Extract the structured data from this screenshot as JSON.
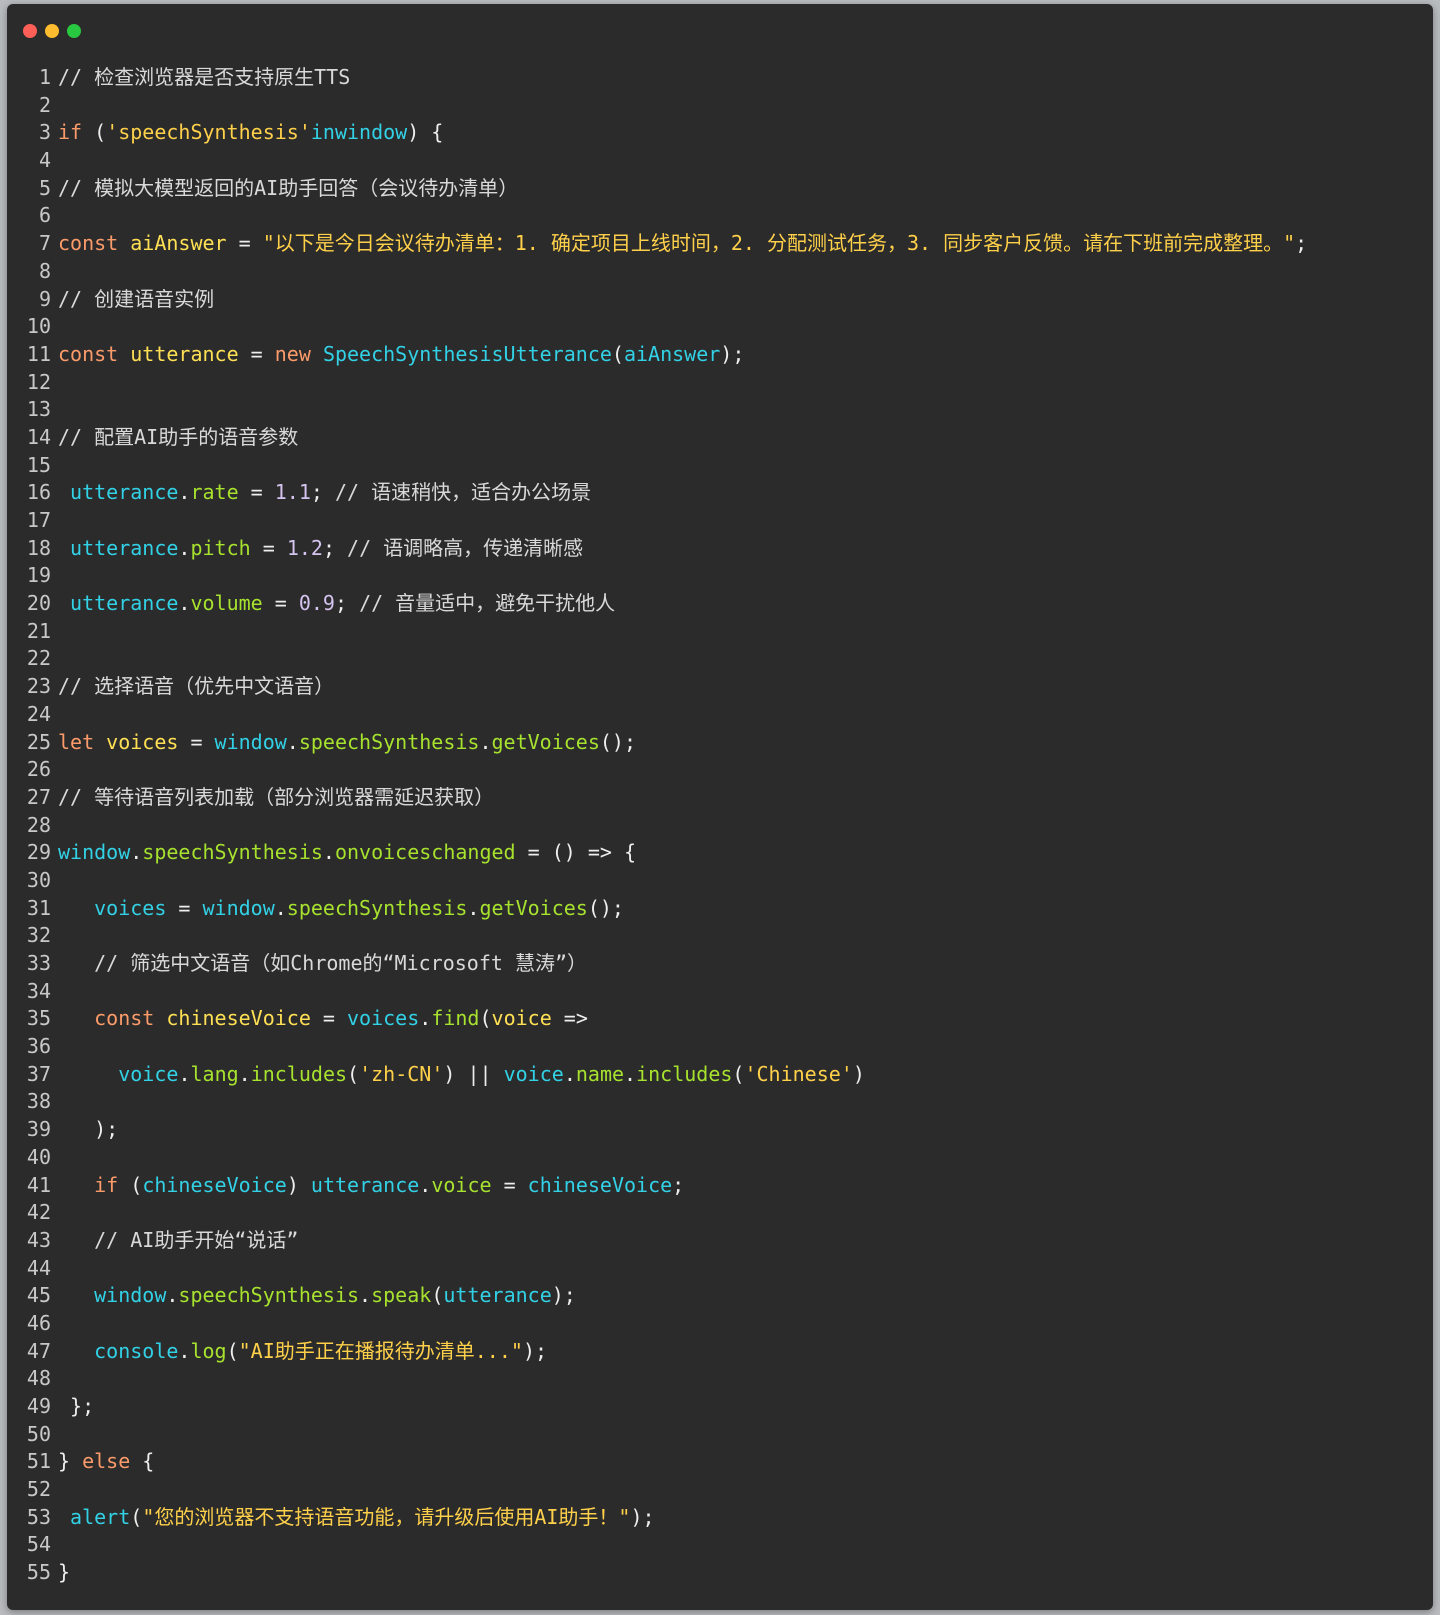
{
  "window": {
    "controls": [
      "close",
      "minimize",
      "zoom"
    ]
  },
  "code_lines": [
    [
      {
        "t": "// 检查浏览器是否支持原生TTS",
        "c": "comment"
      }
    ],
    [],
    [
      {
        "t": "if",
        "c": "keyword"
      },
      {
        "t": " (",
        "c": "punct"
      },
      {
        "t": "'speechSynthesis'",
        "c": "string"
      },
      {
        "t": "inwindow",
        "c": "builtin"
      },
      {
        "t": ") {",
        "c": "punct"
      }
    ],
    [],
    [
      {
        "t": "// 模拟大模型返回的AI助手回答（会议待办清单）",
        "c": "comment"
      }
    ],
    [],
    [
      {
        "t": "const",
        "c": "keyword"
      },
      {
        "t": " ",
        "c": "plain"
      },
      {
        "t": "aiAnswer",
        "c": "var"
      },
      {
        "t": " = ",
        "c": "punct"
      },
      {
        "t": "\"以下是今日会议待办清单：1. 确定项目上线时间，2. 分配测试任务，3. 同步客户反馈。请在下班前完成整理。\"",
        "c": "string"
      },
      {
        "t": ";",
        "c": "punct"
      }
    ],
    [],
    [
      {
        "t": "// 创建语音实例",
        "c": "comment"
      }
    ],
    [],
    [
      {
        "t": "const",
        "c": "keyword"
      },
      {
        "t": " ",
        "c": "plain"
      },
      {
        "t": "utterance",
        "c": "var"
      },
      {
        "t": " = ",
        "c": "punct"
      },
      {
        "t": "new",
        "c": "keyword"
      },
      {
        "t": " ",
        "c": "plain"
      },
      {
        "t": "SpeechSynthesisUtterance",
        "c": "builtin"
      },
      {
        "t": "(",
        "c": "punct"
      },
      {
        "t": "aiAnswer",
        "c": "builtin"
      },
      {
        "t": ");",
        "c": "punct"
      }
    ],
    [],
    [],
    [
      {
        "t": "// 配置AI助手的语音参数",
        "c": "comment"
      }
    ],
    [],
    [
      {
        "t": " ",
        "c": "plain"
      },
      {
        "t": "utterance",
        "c": "builtin"
      },
      {
        "t": ".",
        "c": "punct"
      },
      {
        "t": "rate",
        "c": "func"
      },
      {
        "t": " = ",
        "c": "punct"
      },
      {
        "t": "1.1",
        "c": "number"
      },
      {
        "t": "; ",
        "c": "punct"
      },
      {
        "t": "// 语速稍快，适合办公场景",
        "c": "comment"
      }
    ],
    [],
    [
      {
        "t": " ",
        "c": "plain"
      },
      {
        "t": "utterance",
        "c": "builtin"
      },
      {
        "t": ".",
        "c": "punct"
      },
      {
        "t": "pitch",
        "c": "func"
      },
      {
        "t": " = ",
        "c": "punct"
      },
      {
        "t": "1.2",
        "c": "number"
      },
      {
        "t": "; ",
        "c": "punct"
      },
      {
        "t": "// 语调略高，传递清晰感",
        "c": "comment"
      }
    ],
    [],
    [
      {
        "t": " ",
        "c": "plain"
      },
      {
        "t": "utterance",
        "c": "builtin"
      },
      {
        "t": ".",
        "c": "punct"
      },
      {
        "t": "volume",
        "c": "func"
      },
      {
        "t": " = ",
        "c": "punct"
      },
      {
        "t": "0.9",
        "c": "number"
      },
      {
        "t": "; ",
        "c": "punct"
      },
      {
        "t": "// 音量适中，避免干扰他人",
        "c": "comment"
      }
    ],
    [],
    [],
    [
      {
        "t": "// 选择语音（优先中文语音）",
        "c": "comment"
      }
    ],
    [],
    [
      {
        "t": "let",
        "c": "keyword"
      },
      {
        "t": " ",
        "c": "plain"
      },
      {
        "t": "voices",
        "c": "var"
      },
      {
        "t": " = ",
        "c": "punct"
      },
      {
        "t": "window",
        "c": "builtin"
      },
      {
        "t": ".",
        "c": "punct"
      },
      {
        "t": "speechSynthesis",
        "c": "func"
      },
      {
        "t": ".",
        "c": "punct"
      },
      {
        "t": "getVoices",
        "c": "func"
      },
      {
        "t": "();",
        "c": "punct"
      }
    ],
    [],
    [
      {
        "t": "// 等待语音列表加载（部分浏览器需延迟获取）",
        "c": "comment"
      }
    ],
    [],
    [
      {
        "t": "window",
        "c": "builtin"
      },
      {
        "t": ".",
        "c": "punct"
      },
      {
        "t": "speechSynthesis",
        "c": "func"
      },
      {
        "t": ".",
        "c": "punct"
      },
      {
        "t": "onvoiceschanged",
        "c": "func"
      },
      {
        "t": " = () => {",
        "c": "punct"
      }
    ],
    [],
    [
      {
        "t": "   ",
        "c": "plain"
      },
      {
        "t": "voices",
        "c": "builtin"
      },
      {
        "t": " = ",
        "c": "punct"
      },
      {
        "t": "window",
        "c": "builtin"
      },
      {
        "t": ".",
        "c": "punct"
      },
      {
        "t": "speechSynthesis",
        "c": "func"
      },
      {
        "t": ".",
        "c": "punct"
      },
      {
        "t": "getVoices",
        "c": "func"
      },
      {
        "t": "();",
        "c": "punct"
      }
    ],
    [],
    [
      {
        "t": "   ",
        "c": "plain"
      },
      {
        "t": "// 筛选中文语音（如Chrome的“Microsoft 慧涛”）",
        "c": "comment"
      }
    ],
    [],
    [
      {
        "t": "   ",
        "c": "plain"
      },
      {
        "t": "const",
        "c": "keyword"
      },
      {
        "t": " ",
        "c": "plain"
      },
      {
        "t": "chineseVoice",
        "c": "var"
      },
      {
        "t": " = ",
        "c": "punct"
      },
      {
        "t": "voices",
        "c": "builtin"
      },
      {
        "t": ".",
        "c": "punct"
      },
      {
        "t": "find",
        "c": "func"
      },
      {
        "t": "(",
        "c": "punct"
      },
      {
        "t": "voice",
        "c": "var"
      },
      {
        "t": " =>",
        "c": "punct"
      }
    ],
    [],
    [
      {
        "t": "     ",
        "c": "plain"
      },
      {
        "t": "voice",
        "c": "builtin"
      },
      {
        "t": ".",
        "c": "punct"
      },
      {
        "t": "lang",
        "c": "func"
      },
      {
        "t": ".",
        "c": "punct"
      },
      {
        "t": "includes",
        "c": "func"
      },
      {
        "t": "(",
        "c": "punct"
      },
      {
        "t": "'zh-CN'",
        "c": "string"
      },
      {
        "t": ") || ",
        "c": "punct"
      },
      {
        "t": "voice",
        "c": "builtin"
      },
      {
        "t": ".",
        "c": "punct"
      },
      {
        "t": "name",
        "c": "func"
      },
      {
        "t": ".",
        "c": "punct"
      },
      {
        "t": "includes",
        "c": "func"
      },
      {
        "t": "(",
        "c": "punct"
      },
      {
        "t": "'Chinese'",
        "c": "string"
      },
      {
        "t": ")",
        "c": "punct"
      }
    ],
    [],
    [
      {
        "t": "   );",
        "c": "punct"
      }
    ],
    [],
    [
      {
        "t": "   ",
        "c": "plain"
      },
      {
        "t": "if",
        "c": "keyword"
      },
      {
        "t": " (",
        "c": "punct"
      },
      {
        "t": "chineseVoice",
        "c": "builtin"
      },
      {
        "t": ") ",
        "c": "punct"
      },
      {
        "t": "utterance",
        "c": "builtin"
      },
      {
        "t": ".",
        "c": "punct"
      },
      {
        "t": "voice",
        "c": "func"
      },
      {
        "t": " = ",
        "c": "punct"
      },
      {
        "t": "chineseVoice",
        "c": "builtin"
      },
      {
        "t": ";",
        "c": "punct"
      }
    ],
    [],
    [
      {
        "t": "   ",
        "c": "plain"
      },
      {
        "t": "// AI助手开始“说话”",
        "c": "comment"
      }
    ],
    [],
    [
      {
        "t": "   ",
        "c": "plain"
      },
      {
        "t": "window",
        "c": "builtin"
      },
      {
        "t": ".",
        "c": "punct"
      },
      {
        "t": "speechSynthesis",
        "c": "func"
      },
      {
        "t": ".",
        "c": "punct"
      },
      {
        "t": "speak",
        "c": "func"
      },
      {
        "t": "(",
        "c": "punct"
      },
      {
        "t": "utterance",
        "c": "builtin"
      },
      {
        "t": ");",
        "c": "punct"
      }
    ],
    [],
    [
      {
        "t": "   ",
        "c": "plain"
      },
      {
        "t": "console",
        "c": "builtin"
      },
      {
        "t": ".",
        "c": "punct"
      },
      {
        "t": "log",
        "c": "func"
      },
      {
        "t": "(",
        "c": "punct"
      },
      {
        "t": "\"AI助手正在播报待办清单...\"",
        "c": "string"
      },
      {
        "t": ");",
        "c": "punct"
      }
    ],
    [],
    [
      {
        "t": " };",
        "c": "punct"
      }
    ],
    [],
    [
      {
        "t": "} ",
        "c": "punct"
      },
      {
        "t": "else",
        "c": "keyword"
      },
      {
        "t": " {",
        "c": "punct"
      }
    ],
    [],
    [
      {
        "t": " ",
        "c": "plain"
      },
      {
        "t": "alert",
        "c": "builtin"
      },
      {
        "t": "(",
        "c": "punct"
      },
      {
        "t": "\"您的浏览器不支持语音功能，请升级后使用AI助手！\"",
        "c": "string"
      },
      {
        "t": ");",
        "c": "punct"
      }
    ],
    [],
    [
      {
        "t": "}",
        "c": "punct"
      }
    ]
  ]
}
